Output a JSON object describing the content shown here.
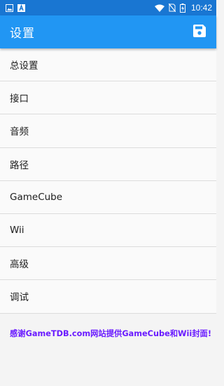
{
  "status_bar": {
    "time": "10:42",
    "left_icons": [
      "image-icon",
      "notification-a-icon"
    ],
    "right_icons": [
      "wifi-icon",
      "no-sim-icon",
      "battery-charging-icon"
    ]
  },
  "app_bar": {
    "title": "设置",
    "action_icon": "save-icon",
    "background": "#2196f3"
  },
  "menu": {
    "items": [
      {
        "label": "总设置"
      },
      {
        "label": "接口"
      },
      {
        "label": "音频"
      },
      {
        "label": "路径"
      },
      {
        "label": "GameCube"
      },
      {
        "label": "Wii"
      },
      {
        "label": "高级"
      },
      {
        "label": "调试"
      }
    ]
  },
  "footer": {
    "credit": "感谢GameTDB.com网站提供GameCube和Wii封面!",
    "color": "#6a1bff"
  }
}
